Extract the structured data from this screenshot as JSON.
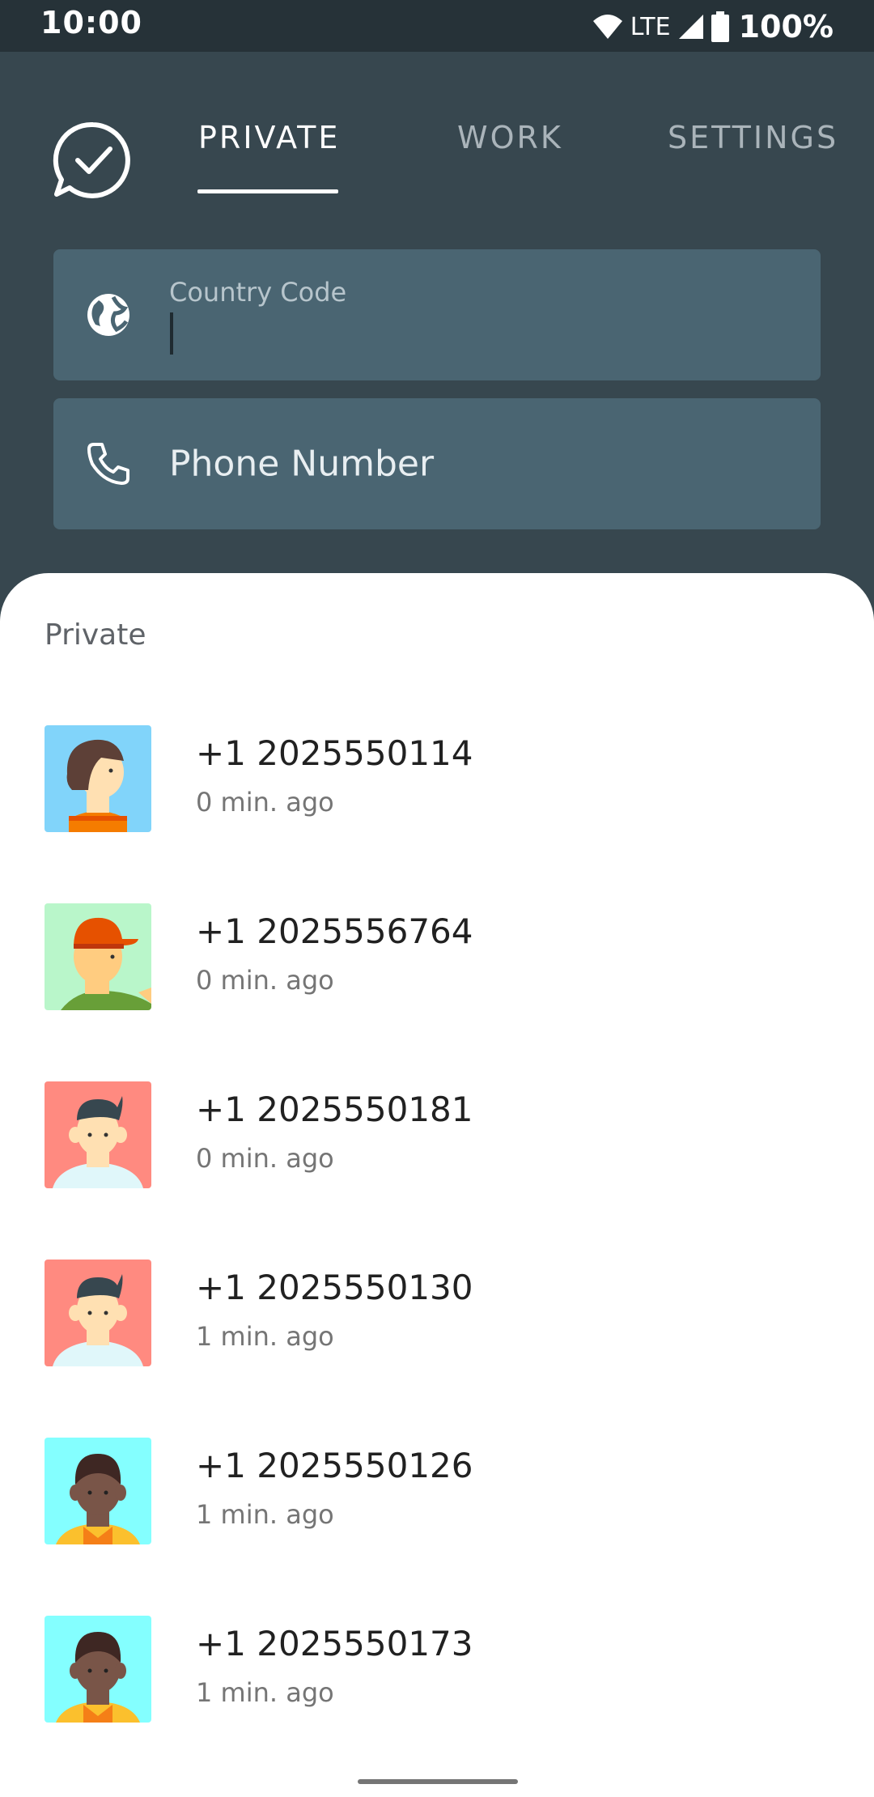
{
  "status_bar": {
    "time": "10:00",
    "network": "LTE",
    "battery": "100%",
    "icons": [
      "wifi-icon",
      "signal-icon",
      "battery-icon"
    ]
  },
  "header": {
    "logo_icon": "chat-check-icon",
    "tabs": [
      {
        "label": "PRIVATE",
        "active": true
      },
      {
        "label": "WORK",
        "active": false
      },
      {
        "label": "SETTINGS",
        "active": false
      }
    ]
  },
  "inputs": {
    "country_code": {
      "label": "Country Code",
      "value": "",
      "icon": "globe-icon"
    },
    "phone_number": {
      "placeholder": "Phone Number",
      "value": "",
      "icon": "phone-icon"
    }
  },
  "list": {
    "title": "Private",
    "contacts": [
      {
        "number": "+1 2025550114",
        "time": "0 min. ago",
        "avatar": "avatar-woman-blue"
      },
      {
        "number": "+1 2025556764",
        "time": "0 min. ago",
        "avatar": "avatar-man-cap-green"
      },
      {
        "number": "+1 2025550181",
        "time": "0 min. ago",
        "avatar": "avatar-boy-red"
      },
      {
        "number": "+1 2025550130",
        "time": "1 min. ago",
        "avatar": "avatar-boy-red"
      },
      {
        "number": "+1 2025550126",
        "time": "1 min. ago",
        "avatar": "avatar-man-dark-cyan"
      },
      {
        "number": "+1 2025550173",
        "time": "1 min. ago",
        "avatar": "avatar-man-dark-cyan"
      }
    ]
  },
  "colors": {
    "header_bg": "#37474f",
    "field_bg": "#4a6572",
    "status_bg": "#263238"
  }
}
